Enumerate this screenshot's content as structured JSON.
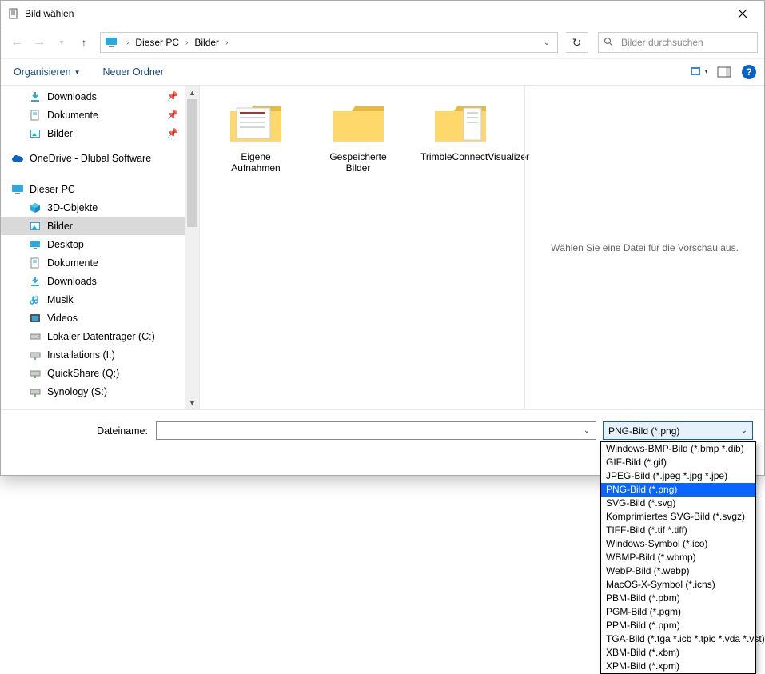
{
  "title": "Bild wählen",
  "nav": {
    "crumb_root": "Dieser PC",
    "crumb_folder": "Bilder"
  },
  "search": {
    "placeholder": "Bilder durchsuchen"
  },
  "toolbar": {
    "organize": "Organisieren",
    "new_folder": "Neuer Ordner"
  },
  "tree": {
    "downloads": "Downloads",
    "documents": "Dokumente",
    "pictures": "Bilder",
    "onedrive": "OneDrive - Dlubal Software",
    "thispc": "Dieser PC",
    "threed": "3D-Objekte",
    "pictures2": "Bilder",
    "desktop": "Desktop",
    "documents2": "Dokumente",
    "downloads2": "Downloads",
    "music": "Musik",
    "videos": "Videos",
    "driveC": "Lokaler Datenträger (C:)",
    "driveI": "Installations (I:)",
    "driveQ": "QuickShare (Q:)",
    "driveS": "Synology (S:)"
  },
  "folders": [
    {
      "name": "Eigene Aufnahmen"
    },
    {
      "name": "Gespeicherte Bilder"
    },
    {
      "name": "TrimbleConnectVisualizer"
    }
  ],
  "preview": {
    "msg": "Wählen Sie eine Datei für die Vorschau aus."
  },
  "footer": {
    "label": "Dateiname:",
    "filter_selected": "PNG-Bild (*.png)"
  },
  "filter_options": [
    "Windows-BMP-Bild (*.bmp *.dib)",
    "GIF-Bild (*.gif)",
    "JPEG-Bild (*.jpeg *.jpg *.jpe)",
    "PNG-Bild (*.png)",
    "SVG-Bild (*.svg)",
    "Komprimiertes SVG-Bild (*.svgz)",
    "TIFF-Bild (*.tif *.tiff)",
    "Windows-Symbol (*.ico)",
    "WBMP-Bild (*.wbmp)",
    "WebP-Bild (*.webp)",
    "MacOS-X-Symbol (*.icns)",
    "PBM-Bild (*.pbm)",
    "PGM-Bild (*.pgm)",
    "PPM-Bild (*.ppm)",
    "TGA-Bild (*.tga *.icb *.tpic *.vda *.vst)",
    "XBM-Bild (*.xbm)",
    "XPM-Bild (*.xpm)"
  ]
}
